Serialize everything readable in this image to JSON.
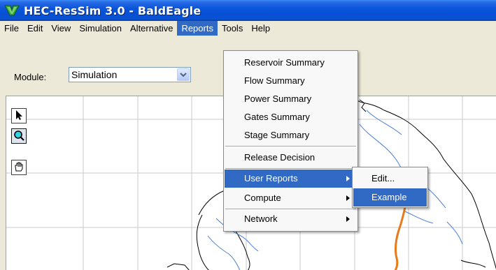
{
  "window": {
    "title": "HEC-ResSim 3.0  - BaldEagle",
    "app_icon": "hec-ressim-icon"
  },
  "menubar": {
    "items": [
      {
        "label": "File"
      },
      {
        "label": "Edit"
      },
      {
        "label": "View"
      },
      {
        "label": "Simulation"
      },
      {
        "label": "Alternative"
      },
      {
        "label": "Reports"
      },
      {
        "label": "Tools"
      },
      {
        "label": "Help"
      }
    ],
    "active": "Reports"
  },
  "module": {
    "label": "Module:",
    "selected": "Simulation"
  },
  "tools": [
    {
      "name": "pointer-icon"
    },
    {
      "name": "zoom-icon"
    },
    {
      "name": "pan-hand-icon"
    }
  ],
  "reports_menu": {
    "items": [
      {
        "label": "Reservoir Summary"
      },
      {
        "label": "Flow Summary"
      },
      {
        "label": "Power Summary"
      },
      {
        "label": "Gates Summary"
      },
      {
        "label": "Stage Summary"
      },
      {
        "label": "Release Decision"
      },
      {
        "label": "User Reports"
      },
      {
        "label": "Compute"
      },
      {
        "label": "Network"
      }
    ]
  },
  "user_reports_submenu": {
    "items": [
      {
        "label": "Edit..."
      },
      {
        "label": "Example"
      }
    ]
  },
  "colors": {
    "highlight": "#316ac5",
    "river": "#4a7fd0",
    "route": "#e87a1a",
    "boundary": "#000000"
  }
}
